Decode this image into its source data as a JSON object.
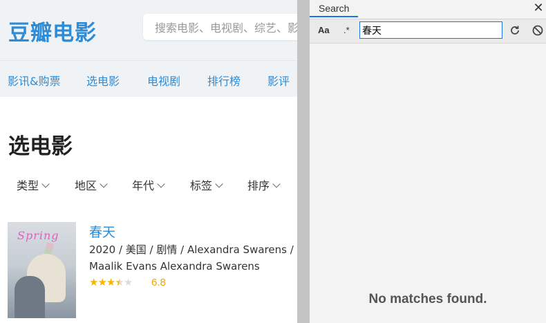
{
  "site": {
    "logo": "豆瓣电影",
    "search_placeholder": "搜索电影、电视剧、综艺、影人",
    "nav": [
      "影讯&购票",
      "选电影",
      "电视剧",
      "排行榜",
      "影评"
    ]
  },
  "page": {
    "title": "选电影",
    "filters": [
      "类型",
      "地区",
      "年代",
      "标签",
      "排序"
    ]
  },
  "movie": {
    "poster_text": "Spring",
    "title": "春天",
    "meta_line1": "2020 / 美国 / 剧情 / Alexandra Swarens /",
    "meta_line2": "Maalik Evans Alexandra Swarens",
    "rating": "6.8",
    "stars": 3.5
  },
  "search_panel": {
    "tab": "Search",
    "match_case_label": "Aa",
    "regex_label": ".*",
    "query": "春天",
    "no_matches": "No matches found."
  },
  "colors": {
    "accent": "#2e8bd6",
    "panel_accent": "#1a73e8",
    "star": "#f7b500"
  }
}
